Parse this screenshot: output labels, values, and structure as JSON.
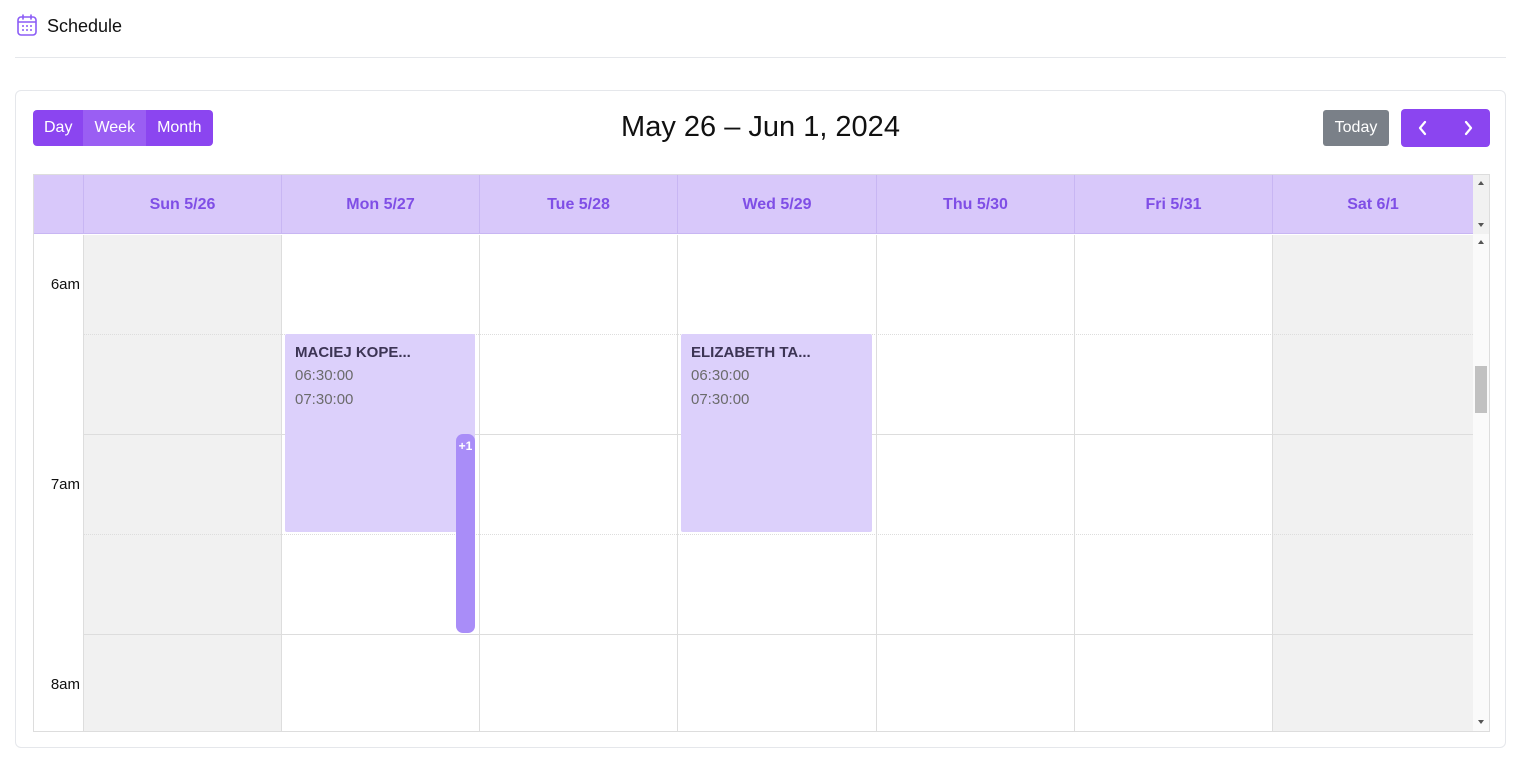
{
  "header": {
    "title": "Schedule",
    "icon": "calendar-icon"
  },
  "toolbar": {
    "views": [
      "Day",
      "Week",
      "Month"
    ],
    "active_view": "Week",
    "date_range": "May 26 – Jun 1, 2024",
    "today_label": "Today",
    "prev_icon": "chevron-left-icon",
    "next_icon": "chevron-right-icon"
  },
  "calendar": {
    "days": [
      {
        "label": "Sun 5/26",
        "weekend": true
      },
      {
        "label": "Mon 5/27",
        "weekend": false
      },
      {
        "label": "Tue 5/28",
        "weekend": false
      },
      {
        "label": "Wed 5/29",
        "weekend": false
      },
      {
        "label": "Thu 5/30",
        "weekend": false
      },
      {
        "label": "Fri 5/31",
        "weekend": false
      },
      {
        "label": "Sat 6/1",
        "weekend": true
      }
    ],
    "times": [
      "6am",
      "7am",
      "8am"
    ],
    "events": [
      {
        "day": "Mon 5/27",
        "name": "MACIEJ KOPE...",
        "start": "06:30:00",
        "end": "07:30:00"
      },
      {
        "day": "Wed 5/29",
        "name": "ELIZABETH TA...",
        "start": "06:30:00",
        "end": "07:30:00"
      }
    ],
    "more_indicator": {
      "day": "Mon 5/27",
      "label": "+1"
    }
  },
  "colors": {
    "accent": "#8b45f0",
    "header_bg": "#d8c8fa",
    "header_text": "#7f4ee6",
    "event_bg": "#dcd0fb",
    "more_bg": "#a98df8",
    "today_bg": "#7a8088",
    "weekend_bg": "#f1f1f1"
  }
}
